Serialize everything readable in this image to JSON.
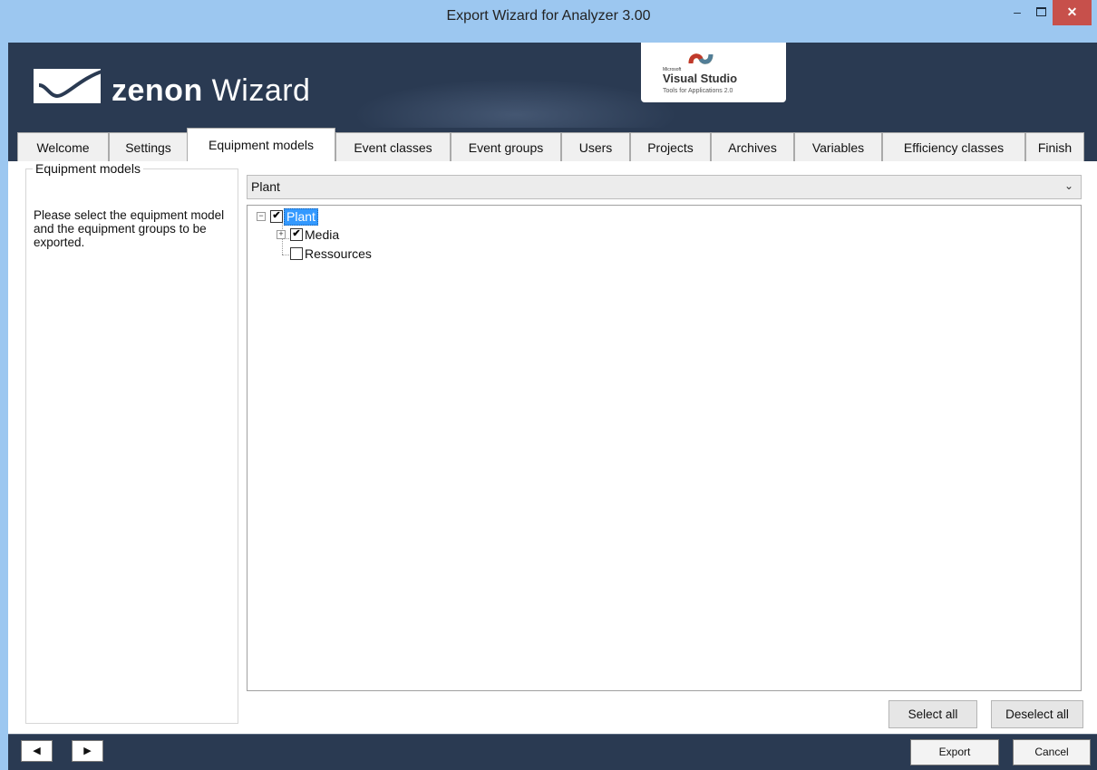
{
  "window": {
    "title": "Export Wizard for Analyzer 3.00",
    "minimize": "–",
    "close": "✕"
  },
  "banner": {
    "logo_brand": "zenon",
    "logo_product": "Wizard",
    "vs_microsoft": "Microsoft",
    "vs_name": "Visual Studio",
    "vs_sub": "Tools for Applications 2.0"
  },
  "tabs": [
    {
      "label": "Welcome"
    },
    {
      "label": "Settings"
    },
    {
      "label": "Equipment models",
      "active": true
    },
    {
      "label": "Event classes"
    },
    {
      "label": "Event groups"
    },
    {
      "label": "Users"
    },
    {
      "label": "Projects"
    },
    {
      "label": "Archives"
    },
    {
      "label": "Variables"
    },
    {
      "label": "Efficiency classes"
    },
    {
      "label": "Finish"
    }
  ],
  "panel": {
    "legend": "Equipment models",
    "description": "Please select the equipment model and the equipment groups to be exported."
  },
  "model_select": {
    "value": "Plant",
    "arrow": "⌄"
  },
  "tree": {
    "root": {
      "label": "Plant",
      "checked": true,
      "expanded": true,
      "selected": true
    },
    "children": [
      {
        "label": "Media",
        "checked": true,
        "expanded": false,
        "has_children": true
      },
      {
        "label": "Ressources",
        "checked": false,
        "has_children": false
      }
    ],
    "collapse_glyph": "−",
    "expand_glyph": "+",
    "check_glyph": "✔"
  },
  "actions": {
    "select_all": "Select all",
    "deselect_all": "Deselect all"
  },
  "footer": {
    "back": "◀",
    "forward": "▶",
    "export": "Export",
    "cancel": "Cancel"
  },
  "colors": {
    "header_bg": "#2a3a52",
    "title_bg": "#9cc7f0",
    "selection": "#3399ff",
    "close": "#c7504b"
  }
}
